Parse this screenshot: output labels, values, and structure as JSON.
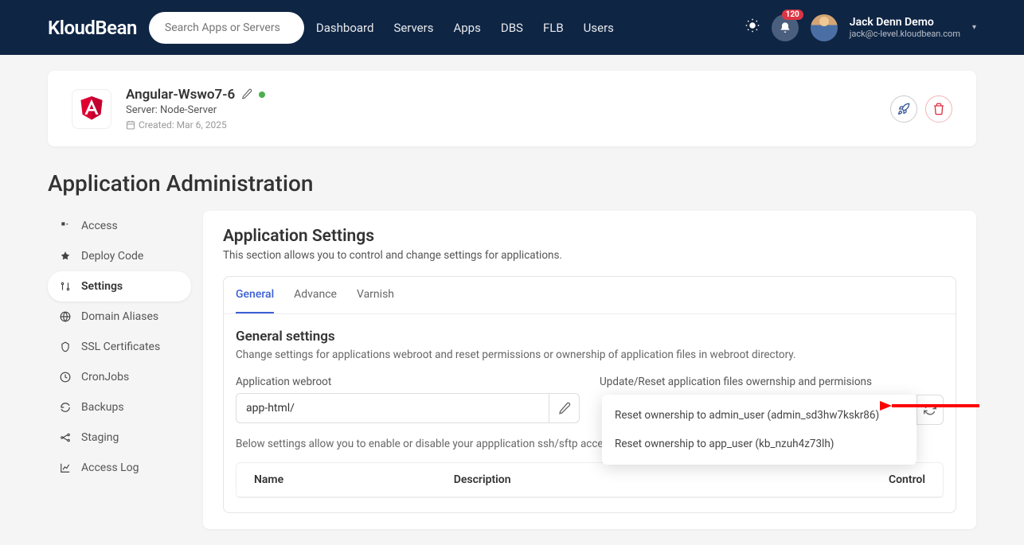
{
  "header": {
    "logo": "KloudBean",
    "search_placeholder": "Search Apps or Servers",
    "nav": [
      "Dashboard",
      "Servers",
      "Apps",
      "DBS",
      "FLB",
      "Users"
    ],
    "notification_count": "120",
    "user_name": "Jack Denn Demo",
    "user_email": "jack@c-level.kloudbean.com"
  },
  "app": {
    "name": "Angular-Wswo7-6",
    "server_label": "Server: Node-Server",
    "created": "Created: Mar 6, 2025"
  },
  "page_title": "Application Administration",
  "sidebar": {
    "items": [
      {
        "label": "Access"
      },
      {
        "label": "Deploy Code"
      },
      {
        "label": "Settings"
      },
      {
        "label": "Domain Aliases"
      },
      {
        "label": "SSL Certificates"
      },
      {
        "label": "CronJobs"
      },
      {
        "label": "Backups"
      },
      {
        "label": "Staging"
      },
      {
        "label": "Access Log"
      }
    ]
  },
  "panel": {
    "title": "Application Settings",
    "desc": "This section allows you to control and change settings for applications."
  },
  "tabs": [
    "General",
    "Advance",
    "Varnish"
  ],
  "general": {
    "section_title": "General settings",
    "section_desc": "Change settings for applications webroot and reset permissions or ownership of application files in webroot directory.",
    "webroot_label": "Application webroot",
    "webroot_value": "app-html/",
    "ownership_label": "Update/Reset application files owernship and permisions",
    "dropdown": [
      "Reset ownership to admin_user (admin_sd3hw7kskr86)",
      "Reset ownership to app_user (kb_nzuh4z73lh)"
    ],
    "note": "Below settings allow you to enable or disable your appplication ssh/sftp acce",
    "table_headers": [
      "Name",
      "Description",
      "Control"
    ]
  }
}
